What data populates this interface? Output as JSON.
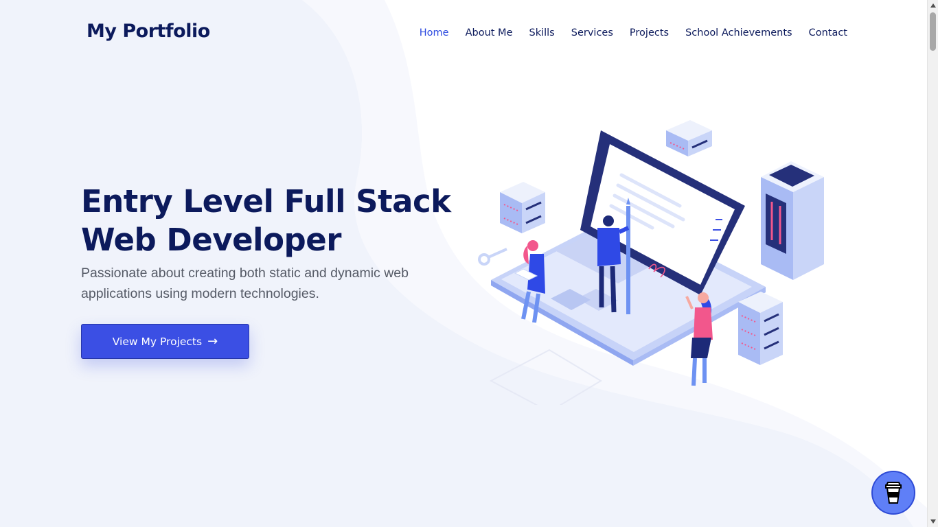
{
  "header": {
    "logo": "My Portfolio",
    "nav": [
      {
        "label": "Home",
        "active": true
      },
      {
        "label": "About Me"
      },
      {
        "label": "Skills"
      },
      {
        "label": "Services"
      },
      {
        "label": "Projects"
      },
      {
        "label": "School Achievements"
      },
      {
        "label": "Contact"
      }
    ]
  },
  "hero": {
    "title_line1": "Entry Level Full Stack",
    "title_line2": "Web Developer",
    "subtitle_line1": "Passionate about creating both static and dynamic web",
    "subtitle_line2": "applications using modern technologies.",
    "cta_label": "View My Projects",
    "cta_icon": "arrow-right-icon"
  },
  "floating_button": {
    "icon": "coffee-cup-icon"
  },
  "colors": {
    "brand_dark": "#0c1a5c",
    "accent": "#3b4fe4",
    "nav_active": "#2b49e0",
    "bg_wave": "#f1f4fc",
    "illus_blue": "#2f49e6",
    "illus_pink": "#f2578c"
  }
}
